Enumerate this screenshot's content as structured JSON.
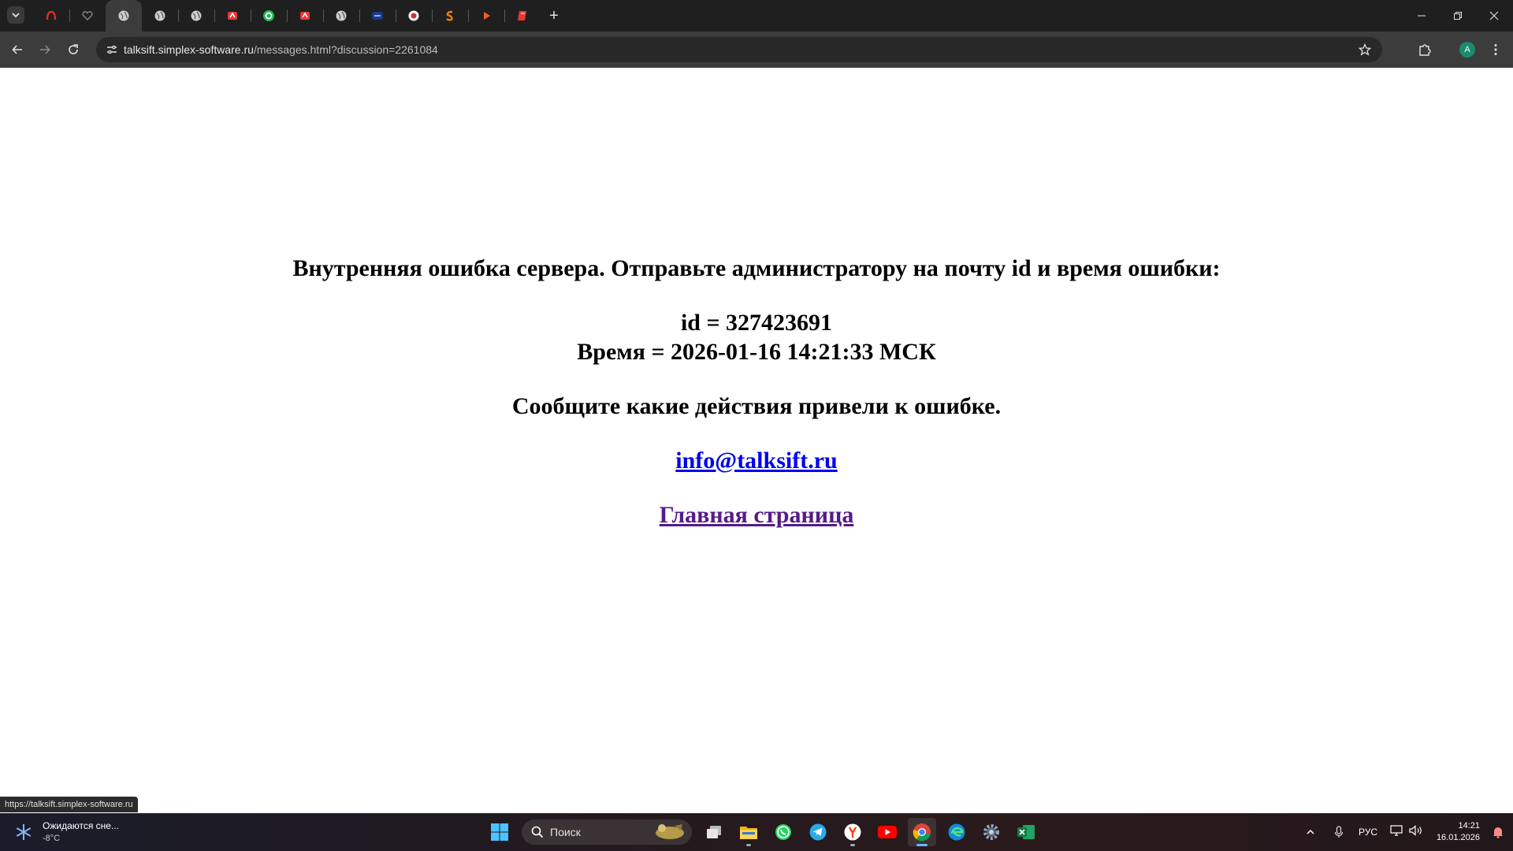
{
  "browser": {
    "url_host": "talksift.simplex-software.ru",
    "url_path": "/messages.html?discussion=2261084",
    "profile_initial": "A",
    "new_tab_symbol": "+"
  },
  "tabs": [
    {
      "icon": "red-arc-icon",
      "active": false
    },
    {
      "icon": "heart-outline-icon",
      "active": false
    },
    {
      "icon": "globe-icon",
      "active": true
    },
    {
      "icon": "globe-icon",
      "active": false
    },
    {
      "icon": "globe-icon",
      "active": false
    },
    {
      "icon": "red-app-icon",
      "active": false
    },
    {
      "icon": "green-circle-icon",
      "active": false
    },
    {
      "icon": "red-app-icon",
      "active": false
    },
    {
      "icon": "globe-icon",
      "active": false
    },
    {
      "icon": "blue-badge-icon",
      "active": false
    },
    {
      "icon": "record-icon",
      "active": false
    },
    {
      "icon": "orange-s-icon",
      "active": false
    },
    {
      "icon": "orange-play-icon",
      "active": false
    },
    {
      "icon": "red-book-icon",
      "active": false
    }
  ],
  "page": {
    "error_heading": "Внутренняя ошибка сервера. Отправьте администратору на почту id и время ошибки:",
    "error_id": "id = 327423691",
    "error_time": "Время = 2026-01-16 14:21:33 МСК",
    "instruction": "Сообщите какие действия привели к ошибке.",
    "email_link": "info@talksift.ru",
    "home_link": "Главная страница"
  },
  "status_url": "https://talksift.simplex-software.ru",
  "taskbar": {
    "weather_title": "Ожидаются сне...",
    "weather_temp": "-8°C",
    "search_placeholder": "Поиск",
    "language": "РУС",
    "time": "14:21",
    "date": "16.01.2026",
    "apps": [
      "start-icon",
      "task-view-icon",
      "file-explorer-icon",
      "whatsapp-icon",
      "telegram-icon",
      "yandex-icon",
      "youtube-icon",
      "chrome-icon",
      "edge-icon",
      "settings-icon",
      "excel-icon"
    ]
  },
  "colors": {
    "link_unvisited": "#0000ee",
    "link_visited": "#551a8b",
    "tabstrip_bg": "#1f1f1f",
    "toolbar_bg": "#3c3c3c"
  }
}
